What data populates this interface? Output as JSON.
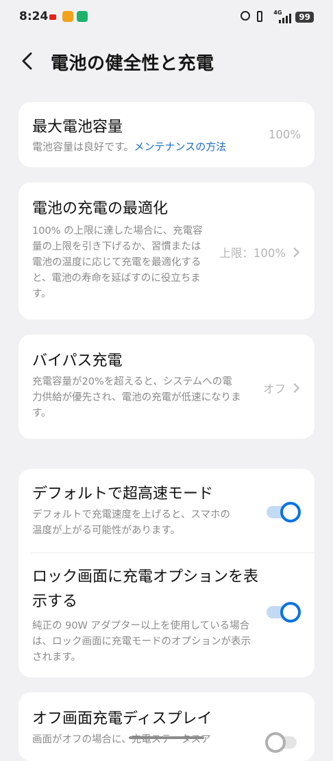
{
  "status_bar": {
    "time": "8:24",
    "network": "4G",
    "battery": "99",
    "icons": [
      "youtube-icon",
      "app-icon-orange",
      "app-icon-green",
      "alarm-icon",
      "vibrate-icon",
      "signal-icon"
    ]
  },
  "header": {
    "back_icon": "back-arrow-icon",
    "title": "電池の健全性と充電"
  },
  "cards": {
    "capacity": {
      "title": "最大電池容量",
      "desc_prefix": "電池容量は良好です。",
      "desc_link": "メンテナンスの方法",
      "value": "100%"
    },
    "optimize": {
      "title": "電池の充電の最適化",
      "desc": "100% の上限に達した場合に、充電容量の上限を引き下げるか、習慣または電池の温度に応じて充電を最適化すると、電池の寿命を延ばすのに役立ちます。",
      "value": "上限：100%"
    },
    "bypass": {
      "title": "バイパス充電",
      "desc": "充電容量が20%を超えると、システムへの電力供給が優先され、電池の充電が低速になります。",
      "value": "オフ"
    },
    "superfast": {
      "title": "デフォルトで超高速モード",
      "desc": "デフォルトで充電速度を上げると、スマホの温度が上がる可能性があります。",
      "enabled": true
    },
    "lockscreen": {
      "title": "ロック画面に充電オプションを表示する",
      "desc": "純正の 90W アダプター以上を使用している場合は、ロック画面に充電モードのオプションが表示されます。",
      "enabled": true
    },
    "offscreen": {
      "title": "オフ画面充電ディスプレイ",
      "desc": "画面がオフの場合に、充電ステータスア",
      "enabled": false
    }
  },
  "colors": {
    "accent": "#0a73e0",
    "link": "#1a6cc7",
    "background": "#f1f1f3"
  }
}
